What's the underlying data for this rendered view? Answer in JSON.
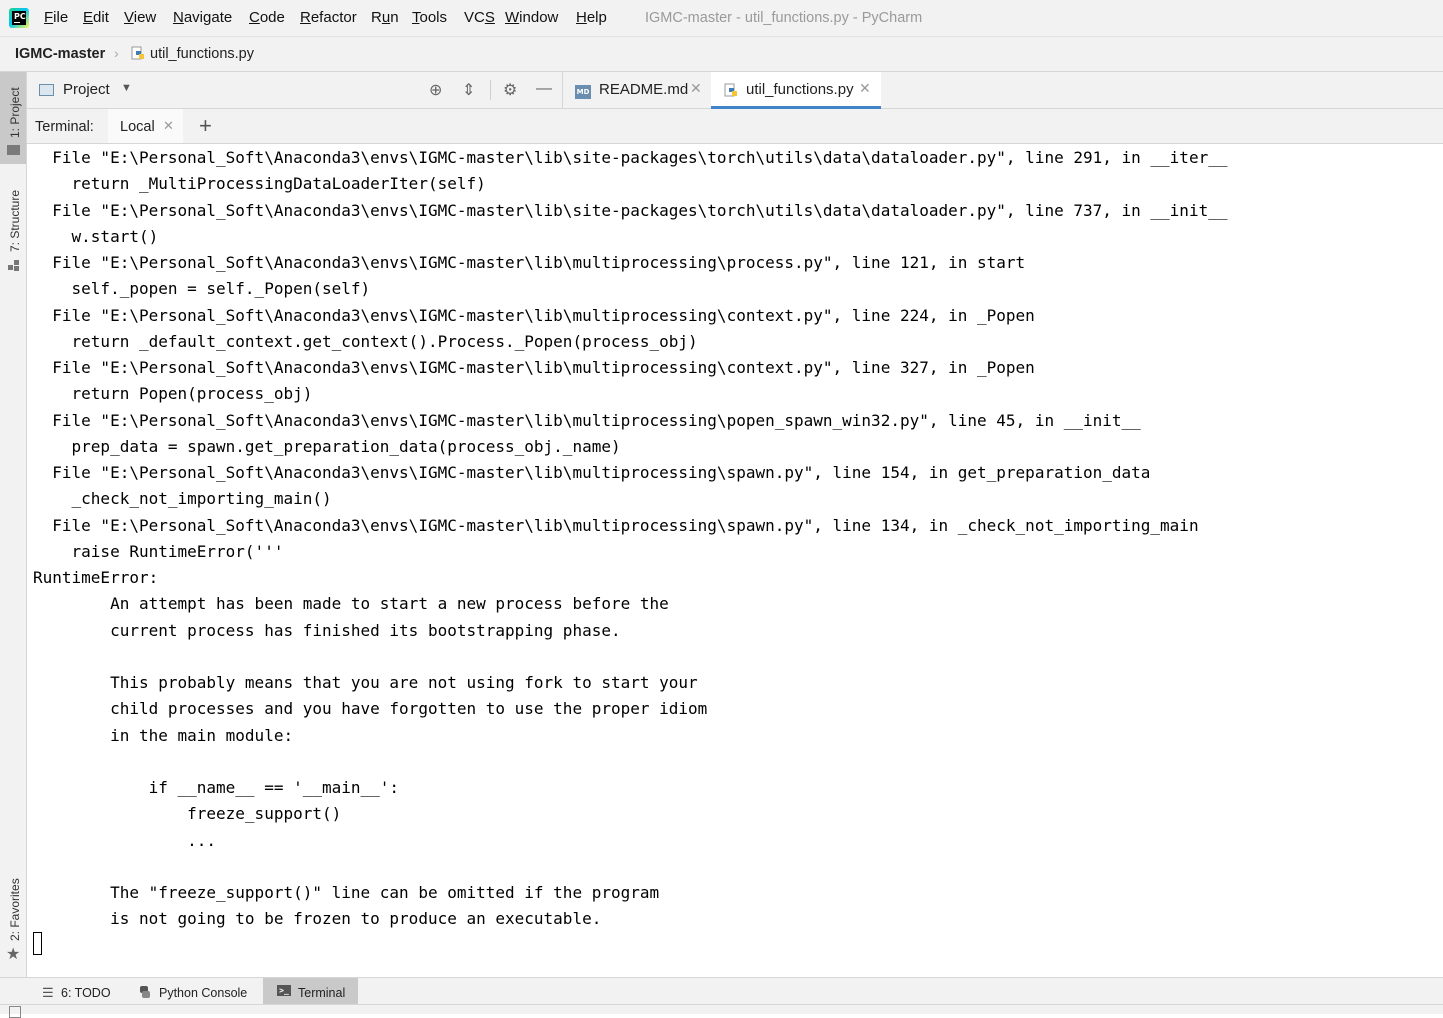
{
  "menubar": {
    "items": [
      {
        "label": "File",
        "underline": "F",
        "rest": "ile"
      },
      {
        "label": "Edit",
        "underline": "E",
        "rest": "dit"
      },
      {
        "label": "View",
        "underline": "V",
        "rest": "iew"
      },
      {
        "label": "Navigate",
        "underline": "N",
        "rest": "avigate"
      },
      {
        "label": "Code",
        "underline": "C",
        "rest": "ode"
      },
      {
        "label": "Refactor",
        "underline": "R",
        "rest": "efactor"
      },
      {
        "label": "Run",
        "pre": "R",
        "underline": "u",
        "rest": "n"
      },
      {
        "label": "Tools",
        "underline": "T",
        "rest": "ools"
      },
      {
        "label": "VCS",
        "pre": "VC",
        "underline": "S",
        "rest": ""
      },
      {
        "label": "Window",
        "underline": "W",
        "rest": "indow"
      },
      {
        "label": "Help",
        "underline": "H",
        "rest": "elp"
      }
    ],
    "window_title": "IGMC-master - util_functions.py - PyCharm",
    "logo_text": "PC"
  },
  "breadcrumb": {
    "root": "IGMC-master",
    "file": "util_functions.py"
  },
  "left_strip": {
    "project_tab": "1: Project",
    "structure_tab": "7: Structure",
    "favorites_tab": "2: Favorites"
  },
  "tool_window": {
    "title": "Project"
  },
  "editor_tabs": [
    {
      "label": "README.md",
      "active": false
    },
    {
      "label": "util_functions.py",
      "active": true
    }
  ],
  "terminal": {
    "title": "Terminal:",
    "tab_label": "Local",
    "lines": [
      "  File \"E:\\Personal_Soft\\Anaconda3\\envs\\IGMC-master\\lib\\site-packages\\torch\\utils\\data\\dataloader.py\", line 291, in __iter__",
      "    return _MultiProcessingDataLoaderIter(self)",
      "  File \"E:\\Personal_Soft\\Anaconda3\\envs\\IGMC-master\\lib\\site-packages\\torch\\utils\\data\\dataloader.py\", line 737, in __init__",
      "    w.start()",
      "  File \"E:\\Personal_Soft\\Anaconda3\\envs\\IGMC-master\\lib\\multiprocessing\\process.py\", line 121, in start",
      "    self._popen = self._Popen(self)",
      "  File \"E:\\Personal_Soft\\Anaconda3\\envs\\IGMC-master\\lib\\multiprocessing\\context.py\", line 224, in _Popen",
      "    return _default_context.get_context().Process._Popen(process_obj)",
      "  File \"E:\\Personal_Soft\\Anaconda3\\envs\\IGMC-master\\lib\\multiprocessing\\context.py\", line 327, in _Popen",
      "    return Popen(process_obj)",
      "  File \"E:\\Personal_Soft\\Anaconda3\\envs\\IGMC-master\\lib\\multiprocessing\\popen_spawn_win32.py\", line 45, in __init__",
      "    prep_data = spawn.get_preparation_data(process_obj._name)",
      "  File \"E:\\Personal_Soft\\Anaconda3\\envs\\IGMC-master\\lib\\multiprocessing\\spawn.py\", line 154, in get_preparation_data",
      "    _check_not_importing_main()",
      "  File \"E:\\Personal_Soft\\Anaconda3\\envs\\IGMC-master\\lib\\multiprocessing\\spawn.py\", line 134, in _check_not_importing_main",
      "    raise RuntimeError('''",
      "RuntimeError:",
      "        An attempt has been made to start a new process before the",
      "        current process has finished its bootstrapping phase.",
      "",
      "        This probably means that you are not using fork to start your",
      "        child processes and you have forgotten to use the proper idiom",
      "        in the main module:",
      "",
      "            if __name__ == '__main__':",
      "                freeze_support()",
      "                ...",
      "",
      "        The \"freeze_support()\" line can be omitted if the program",
      "        is not going to be frozen to produce an executable."
    ]
  },
  "bottom_tools": [
    {
      "label": "6: TODO",
      "active": false
    },
    {
      "label": "Python Console",
      "active": false
    },
    {
      "label": "Terminal",
      "active": true
    }
  ],
  "colors": {
    "chrome_bg": "#f2f2f2",
    "active_tab_underline": "#4083c9",
    "active_tool_bg": "#c9c9c9"
  }
}
